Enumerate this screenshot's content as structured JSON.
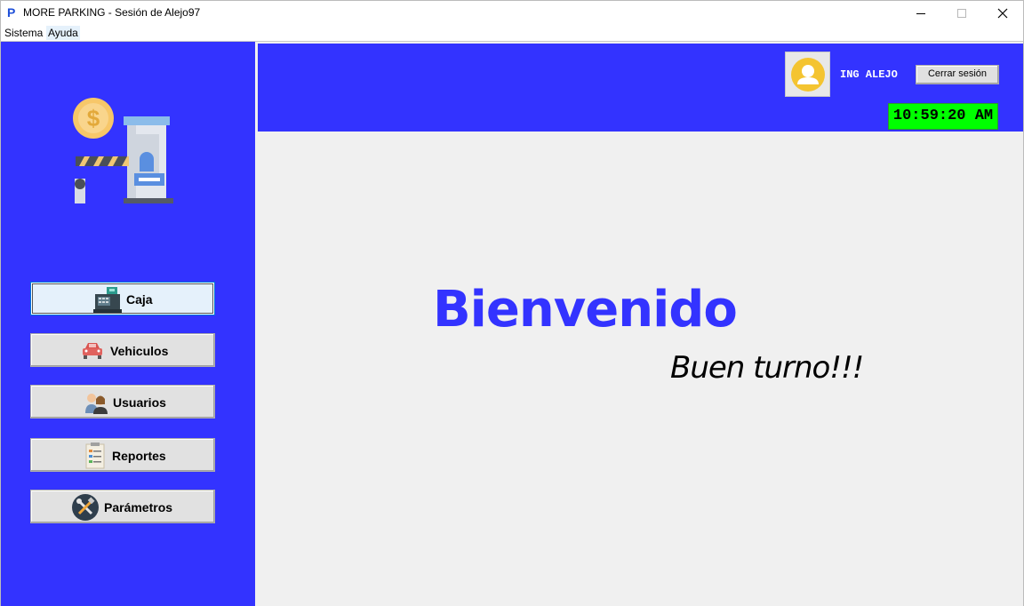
{
  "window": {
    "app_icon": "P",
    "title": "MORE PARKING - Sesión de Alejo97"
  },
  "menu": {
    "items": [
      "Sistema",
      "Ayuda"
    ]
  },
  "sidebar": {
    "logo": "parking-booth-logo",
    "buttons": [
      {
        "label": "Caja",
        "icon": "cash-register-icon",
        "active": true
      },
      {
        "label": "Vehiculos",
        "icon": "car-icon",
        "active": false
      },
      {
        "label": "Usuarios",
        "icon": "users-icon",
        "active": false
      },
      {
        "label": "Reportes",
        "icon": "report-icon",
        "active": false
      },
      {
        "label": "Parámetros",
        "icon": "tools-icon",
        "active": false
      }
    ]
  },
  "header": {
    "avatar_icon": "user-avatar-icon",
    "user_name": "ING ALEJO",
    "logout_label": "Cerrar sesión",
    "clock": "10:59:20 AM"
  },
  "main": {
    "welcome": "Bienvenido",
    "subtitle": "Buen turno!!!"
  },
  "colors": {
    "primary": "#3333ff",
    "clock_bg": "#00ff00",
    "content_bg": "#f0f0f0"
  }
}
